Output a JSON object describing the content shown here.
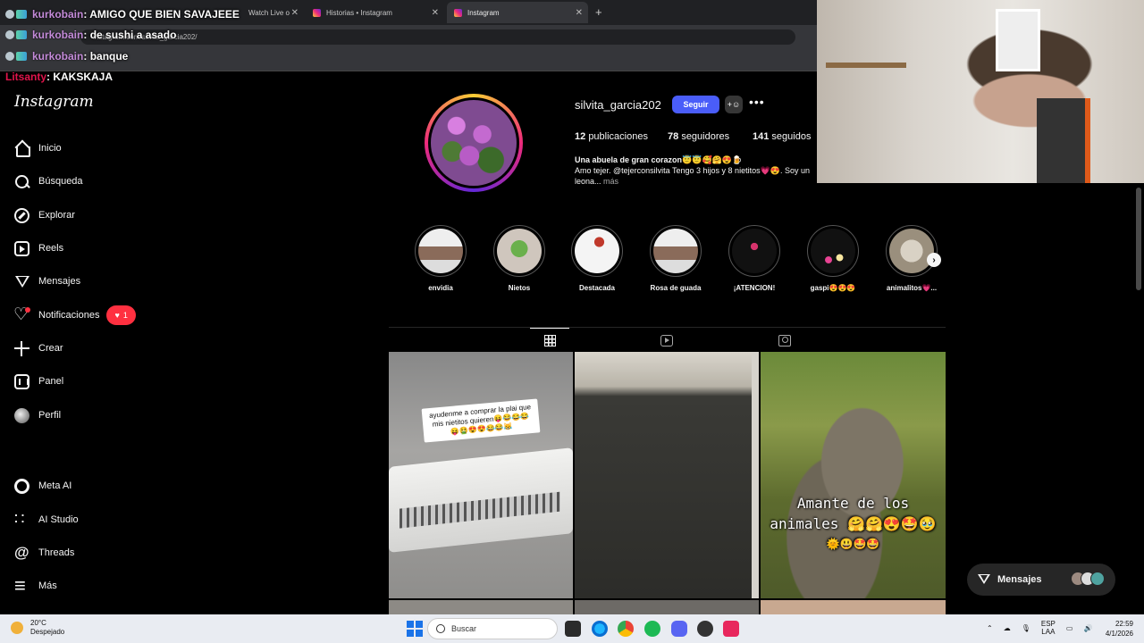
{
  "browser": {
    "tabs": [
      {
        "label": "Watch Live o"
      },
      {
        "label": "Historias • Instagram"
      },
      {
        "label": "Instagram"
      }
    ],
    "url": "instagram.com/silvita_garcia202/"
  },
  "chat": [
    {
      "user": "kurkobain",
      "message": ": AMIGO QUE BIEN SAVAJEEE"
    },
    {
      "user": "kurkobain",
      "message": ": de sushi a asado"
    },
    {
      "user": "kurkobain",
      "message": ": banque"
    },
    {
      "user": "Litsanty",
      "message": ": KAKSKAJA"
    }
  ],
  "sidebar": {
    "logo": "Instagram",
    "items": [
      {
        "label": "Inicio",
        "icon": "home-icon"
      },
      {
        "label": "Búsqueda",
        "icon": "search-icon"
      },
      {
        "label": "Explorar",
        "icon": "compass-icon"
      },
      {
        "label": "Reels",
        "icon": "reels-icon"
      },
      {
        "label": "Mensajes",
        "icon": "messenger-icon"
      },
      {
        "label": "Notificaciones",
        "icon": "heart-icon"
      },
      {
        "label": "Crear",
        "icon": "plus-icon"
      },
      {
        "label": "Panel",
        "icon": "panel-icon"
      },
      {
        "label": "Perfil",
        "icon": "avatar-icon"
      },
      {
        "label": "Meta AI",
        "icon": "meta-ai-icon"
      },
      {
        "label": "AI Studio",
        "icon": "ai-studio-icon"
      },
      {
        "label": "Threads",
        "icon": "threads-icon"
      },
      {
        "label": "Más",
        "icon": "menu-icon"
      }
    ],
    "notification_count": "1"
  },
  "profile": {
    "username": "silvita_garcia202",
    "follow_label": "Seguir",
    "posts_count": "12",
    "posts_label": "publicaciones",
    "followers_count": "78",
    "followers_label": "seguidores",
    "following_count": "141",
    "following_label": "seguidos",
    "bio_name": "Una abuela de gran corazon😇😇🥰🤗😍🍺",
    "bio_line": "Amo tejer. @tejerconsilvita Tengo 3 hijos y 8 nietitos💗😍. Soy un",
    "bio_line2": "leona...",
    "bio_more": "más"
  },
  "highlights": [
    {
      "label": "envidia"
    },
    {
      "label": "Nietos"
    },
    {
      "label": "Destacada"
    },
    {
      "label": "Rosa de guada"
    },
    {
      "label": "¡ATENCION!"
    },
    {
      "label": "gaspi😍😍😍"
    },
    {
      "label": "animalitos💗..."
    }
  ],
  "posts": [
    {
      "caption": "ayudenme a comprar la plai que mis nietitos quieren😝😂😂😂😝🤮😍😍😂😂😹"
    },
    {
      "caption": ""
    },
    {
      "caption_line1": "Amante de los",
      "caption_line2": "animales 🤗🤗😍🤩🥹",
      "caption_line3": "🌞😃🤩🤩"
    }
  ],
  "floating_messages": {
    "label": "Mensajes"
  },
  "taskbar": {
    "temp": "20°C",
    "weather": "Despejado",
    "search_placeholder": "Buscar",
    "lang1": "ESP",
    "lang2": "LAA",
    "time": "22:59",
    "date": "4/1/2026"
  },
  "colors": {
    "accent": "#4a5df9",
    "notif": "#ff3040",
    "bg": "#000000"
  }
}
